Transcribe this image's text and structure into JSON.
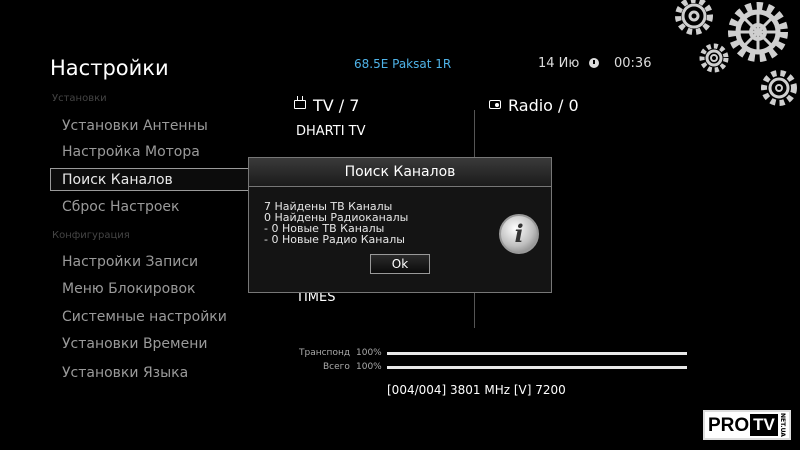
{
  "header": {
    "title": "Настройки",
    "satellite": "68.5E Paksat 1R",
    "date": "14 Ию",
    "time": "00:36"
  },
  "menu": {
    "section_install": "Установки",
    "section_config": "Конфигурация",
    "items": [
      "Установки Антенны",
      "Настройка Мотора",
      "Поиск Каналов",
      "Сброс Настроек",
      "Настройки Записи",
      "Меню Блокировок",
      "Системные настройки",
      "Установки Времени",
      "Установки Языка"
    ],
    "selected": "Поиск Каналов"
  },
  "columns": {
    "tv_label": "TV / 7",
    "radio_label": "Radio / 0",
    "tv_channels": [
      "DHARTI TV",
      "TIMES"
    ]
  },
  "progress": {
    "transponder_label": "Транспонд",
    "transponder_value": "100%",
    "transponder_fraction": 1.0,
    "total_label": "Всего",
    "total_value": "100%",
    "total_fraction": 1.0,
    "frequency": "[004/004] 3801 MHz [V] 7200"
  },
  "dialog": {
    "title": "Поиск Каналов",
    "lines": [
      "7 Найдены ТВ Каналы",
      "0 Найдены Радиоканалы",
      "- 0 Новые ТВ Каналы",
      "- 0 Новые Радио Каналы"
    ],
    "ok_label": "Ok",
    "info_glyph": "i"
  },
  "logo": {
    "pro": "PRO",
    "tv": "TV",
    "net": "NET.UA"
  },
  "colors": {
    "satellite": "#4fb3e8",
    "background": "#000000"
  }
}
